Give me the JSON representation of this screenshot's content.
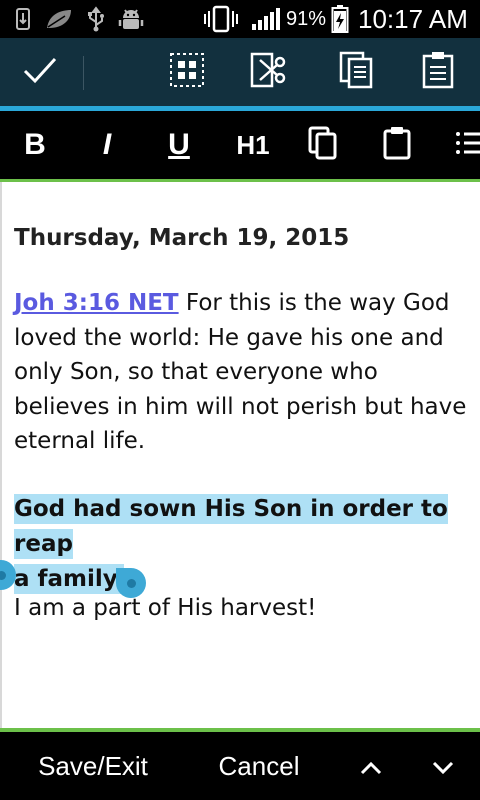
{
  "status_bar": {
    "battery_percent": "91%",
    "time": "10:17 AM",
    "icons": [
      "usb-storage-icon",
      "leaf-icon",
      "usb-icon",
      "android-debug-icon",
      "vibrate-icon",
      "signal-icon",
      "battery-charging-icon"
    ]
  },
  "action_bar": {
    "buttons": [
      "done-check-icon",
      "select-all-icon",
      "cut-icon",
      "copy-icon",
      "paste-icon"
    ]
  },
  "format_bar": {
    "bold_label": "B",
    "italic_label": "I",
    "underline_label": "U",
    "heading_label": "H1",
    "buttons": [
      "bold-button",
      "italic-button",
      "underline-button",
      "heading-button",
      "copy-icon",
      "paste-icon",
      "list-icon"
    ]
  },
  "editor": {
    "date_heading": "Thursday, March 19, 2015",
    "verse_link": "Joh 3:16 NET",
    "verse_text": " For this is the way God loved the world: He gave his one and only Son, so that everyone who believes in him will not perish but have eternal life.",
    "highlight_line1": "God had sown His Son in order to reap",
    "highlight_line2": "a family.",
    "harvest_text": "I am a part of His harvest!"
  },
  "bottom_bar": {
    "save_label": "Save/Exit",
    "cancel_label": "Cancel",
    "up_icon": "chevron-up-icon",
    "down_icon": "chevron-down-icon"
  },
  "colors": {
    "action_bar_bg": "#12303e",
    "accent_blue": "#2aa7d8",
    "accent_green": "#6cc04a",
    "link": "#5a5ae0",
    "selection": "#aee0f5",
    "handle": "#3ea9d6"
  }
}
